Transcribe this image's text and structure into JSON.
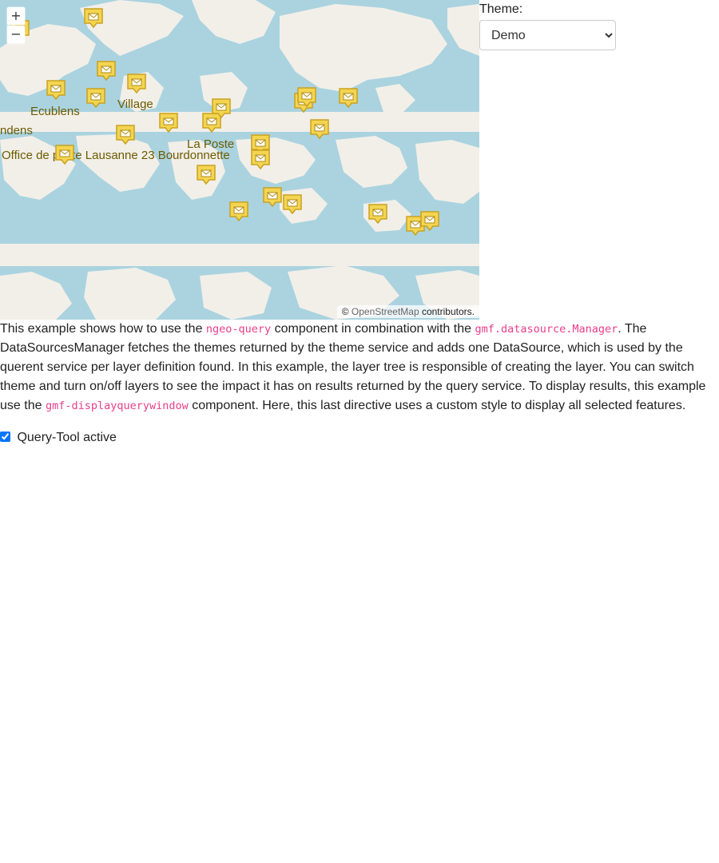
{
  "map": {
    "zoom_in_label": "+",
    "zoom_out_label": "−",
    "attribution": {
      "prefix": "© ",
      "link": "OpenStreetMap",
      "suffix": " contributors."
    },
    "place_labels": [
      "Ecublens",
      "Village",
      "ndens",
      "Office de poste Lausanne 23 Bourdonnette",
      "La Poste"
    ],
    "marker_icon": "post-office-envelope-icon",
    "colors": {
      "water": "#aad3df",
      "land": "#f2efe9",
      "marker_fill": "#f3d552",
      "marker_stroke": "#c9a21f"
    }
  },
  "theme": {
    "label": "Theme:",
    "selected": "Demo"
  },
  "description": {
    "p1": "This example shows how to use the ",
    "code1": "ngeo-query",
    "p2": " component in combination with the ",
    "code2": "gmf.datasource.Manager",
    "p3": ". The DataSourcesManager fetches the themes returned by the theme service and adds one DataSource, which is used by the querent service per layer definition found. In this example, the layer tree is responsible of creating the layer. You can switch theme and turn on/off layers to see the impact it has on results returned by the query service. To display results, this example use the ",
    "code3": "gmf-displayquerywindow",
    "p4": "  component. Here, this last directive uses a custom style to display all selected features."
  },
  "query_tool": {
    "label": "Query-Tool active",
    "checked": true
  }
}
